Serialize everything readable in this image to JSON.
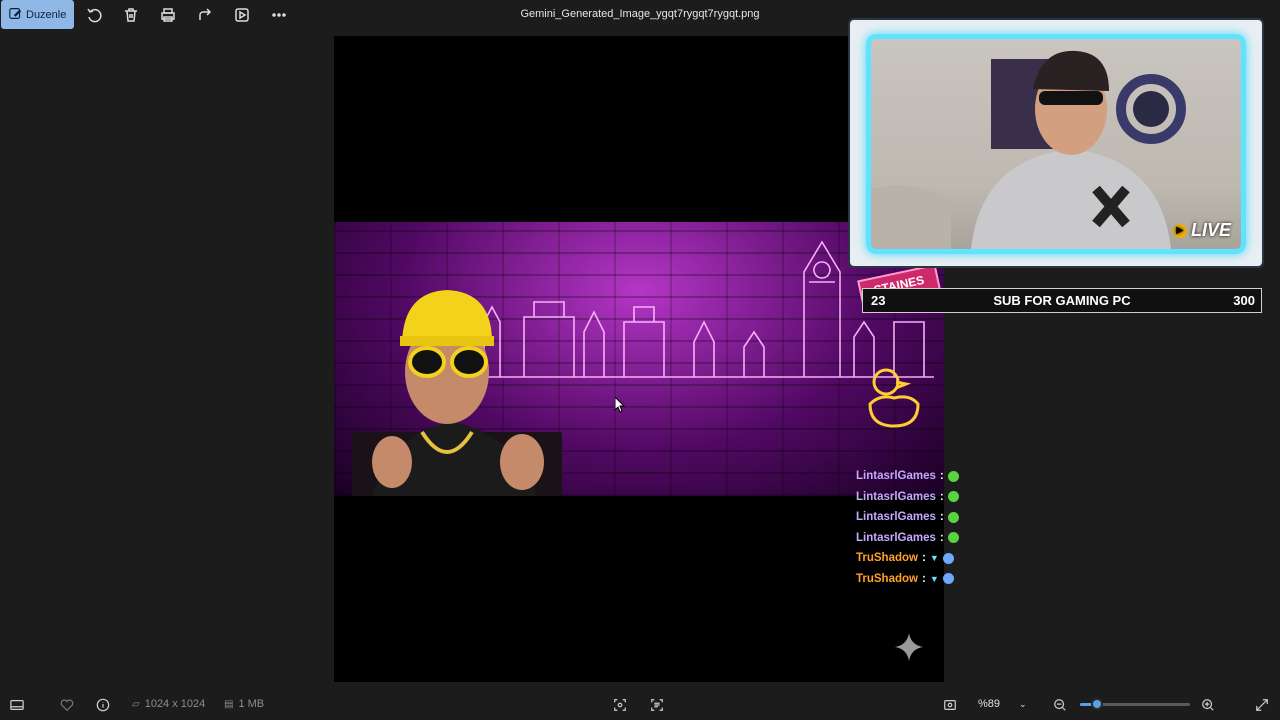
{
  "toolbar": {
    "edit_label": "Duzenle",
    "icons": [
      "rotate-icon",
      "delete-icon",
      "print-icon",
      "share-icon",
      "slideshow-icon",
      "more-icon"
    ]
  },
  "window": {
    "title": "Gemini_Generated_Image_ygqt7rygqt7rygqt.png"
  },
  "image": {
    "sign_text": "STAINES"
  },
  "overlay": {
    "live_label": "LIVE",
    "sub_goal": {
      "current": "23",
      "label": "SUB FOR GAMING PC",
      "target": "300"
    },
    "chat": [
      {
        "user": "LintasrlGames",
        "sep": ":",
        "color": "#c6a8ff",
        "emote": "#5ad43e"
      },
      {
        "user": "LintasrlGames",
        "sep": ":",
        "color": "#c6a8ff",
        "emote": "#5ad43e"
      },
      {
        "user": "LintasrlGames",
        "sep": ":",
        "color": "#c6a8ff",
        "emote": "#5ad43e"
      },
      {
        "user": "LintasrlGames",
        "sep": ":",
        "color": "#c6a8ff",
        "emote": "#5ad43e"
      },
      {
        "user": "TruShadow",
        "sep": ":",
        "color": "#ffa12a",
        "emote": "#6fa8ff"
      },
      {
        "user": "TruShadow",
        "sep": ":",
        "color": "#ffa12a",
        "emote": "#6fa8ff"
      }
    ]
  },
  "statusbar": {
    "dimensions": "1024 x 1024",
    "file_size": "1 MB",
    "zoom": "%89",
    "zoom_fraction": 0.15
  }
}
